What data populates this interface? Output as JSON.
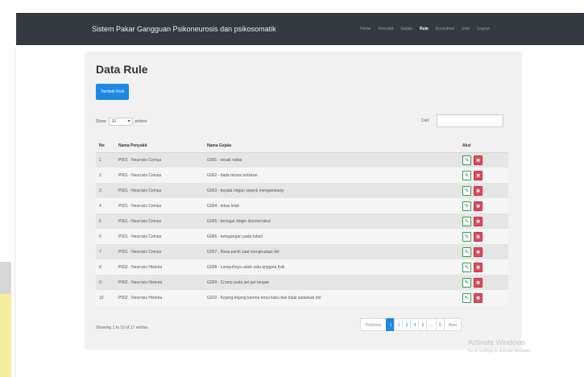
{
  "navbar": {
    "brand": "Sistem Pakar Gangguan Psikoneurosis dan psikosomatik",
    "links": [
      "Home",
      "Penyakit",
      "Gejala",
      "Rule",
      "Konsultasi",
      "User",
      "Logout"
    ]
  },
  "page": {
    "title": "Data Rule"
  },
  "toolbar": {
    "add_label": "Tambah Rule"
  },
  "datatable": {
    "show_label": "Show",
    "show_value": "10",
    "entries_label": "entries",
    "search_label": "Cari:",
    "search_value": ""
  },
  "table": {
    "headers": {
      "no": "No",
      "penyakit": "Nama Penyakit",
      "gejala": "Nama Gejala",
      "aksi": "Aksi"
    },
    "rows": [
      {
        "no": "1",
        "penyakit": "P001 - Neurosis Cemas",
        "gejala": "G001 - sesak nafas"
      },
      {
        "no": "2",
        "penyakit": "P001 - Neurosis Cemas",
        "gejala": "G002 - dada terasa tertekan"
      },
      {
        "no": "3",
        "penyakit": "P001 - Neurosis Cemas",
        "gejala": "G003 - kepala ringan seperti mengambang"
      },
      {
        "no": "4",
        "penyakit": "P001 - Neurosis Cemas",
        "gejala": "G004 - lekas lelah"
      },
      {
        "no": "5",
        "penyakit": "P001 - Neurosis Cemas",
        "gejala": "G005 - keringat dingin disertai takut"
      },
      {
        "no": "6",
        "penyakit": "P001 - Neurosis Cemas",
        "gejala": "G006 - ketegangan pada tubuh"
      },
      {
        "no": "7",
        "penyakit": "P001 - Neurosis Cemas",
        "gejala": "G007 - Rasa panik saat menghadapi diri"
      },
      {
        "no": "8",
        "penyakit": "P002 - Neurosis Histeria",
        "gejala": "G008 - Lumpuhnya salah satu anggota fisik"
      },
      {
        "no": "9",
        "penyakit": "P002 - Neurosis Histeria",
        "gejala": "G009 - Cramp pada jari-jari tangan"
      },
      {
        "no": "10",
        "penyakit": "P002 - Neurosis Histeria",
        "gejala": "G010 - Kejang-kejang karena terus kaku dan tidak sadarkan diri"
      }
    ]
  },
  "footer": {
    "info": "Showing 1 to 10 of 17 entries",
    "pagination": [
      "Previous",
      "1",
      "2",
      "3",
      "4",
      "5",
      "...",
      "9",
      "Next"
    ],
    "active_page": "1"
  },
  "watermark": {
    "line1": "Activate Windows",
    "line2": "Go to Settings to activate Windows."
  },
  "colors": {
    "navbar": "#343a40",
    "primary": "#1e88e5",
    "edit": "#2e9e4a",
    "delete": "#e24a5a"
  },
  "icons": {
    "edit": "pencil-icon",
    "delete": "trash-icon"
  }
}
